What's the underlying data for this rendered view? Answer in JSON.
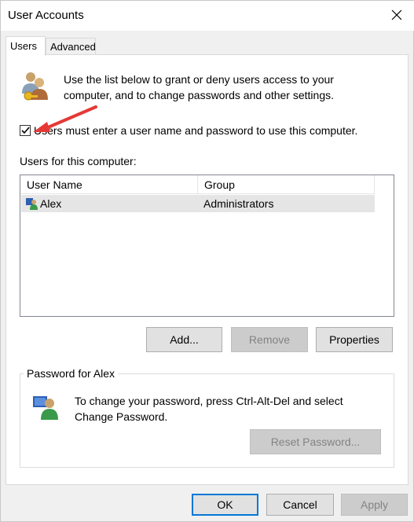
{
  "window": {
    "title": "User Accounts",
    "close_glyph": "✕"
  },
  "tabs": [
    {
      "label": "Users",
      "active": true
    },
    {
      "label": "Advanced",
      "active": false
    }
  ],
  "users_tab": {
    "intro_text": "Use the list below to grant or deny users access to your computer, and to change passwords and other settings.",
    "require_login": {
      "label": "Users must enter a user name and password to use this computer.",
      "checked": true
    },
    "list_label": "Users for this computer:",
    "columns": [
      "User Name",
      "Group"
    ],
    "rows": [
      {
        "user_name": "Alex",
        "group": "Administrators",
        "icon": "admin-user-icon"
      }
    ],
    "buttons": {
      "add": "Add...",
      "remove": "Remove",
      "properties": "Properties"
    },
    "password_group": {
      "title": "Password for Alex",
      "text": "To change your password, press Ctrl-Alt-Del and select Change Password.",
      "reset_button": "Reset Password..."
    }
  },
  "footer": {
    "ok": "OK",
    "cancel": "Cancel",
    "apply": "Apply"
  },
  "colors": {
    "accent": "#0078d7",
    "annotation_arrow": "#e53935"
  }
}
